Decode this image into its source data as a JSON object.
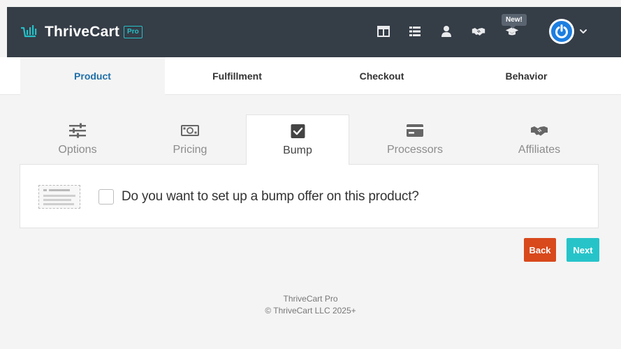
{
  "header": {
    "brand_name": "ThriveCart",
    "brand_badge": "Pro",
    "new_badge": "New!",
    "icons": [
      "layout-icon",
      "grid-list-icon",
      "user-icon",
      "handshake-icon",
      "graduation-cap-icon",
      "power-icon",
      "chevron-down-icon"
    ],
    "accent_color": "#26c0c8",
    "background_color": "#353d47"
  },
  "main_tabs": [
    {
      "label": "Product",
      "active": true
    },
    {
      "label": "Fulfillment",
      "active": false
    },
    {
      "label": "Checkout",
      "active": false
    },
    {
      "label": "Behavior",
      "active": false
    }
  ],
  "sub_tabs": [
    {
      "label": "Options",
      "icon": "sliders-icon",
      "active": false
    },
    {
      "label": "Pricing",
      "icon": "money-icon",
      "active": false
    },
    {
      "label": "Bump",
      "icon": "checkbox-icon",
      "active": true
    },
    {
      "label": "Processors",
      "icon": "credit-card-icon",
      "active": false
    },
    {
      "label": "Affiliates",
      "icon": "handshake-icon",
      "active": false
    }
  ],
  "bump_panel": {
    "question": "Do you want to set up a bump offer on this product?",
    "checked": false
  },
  "actions": {
    "back_label": "Back",
    "next_label": "Next",
    "back_color": "#d8491c",
    "next_color": "#26c4c9"
  },
  "footer": {
    "line1": "ThriveCart Pro",
    "line2": "© ThriveCart LLC 2025+"
  }
}
